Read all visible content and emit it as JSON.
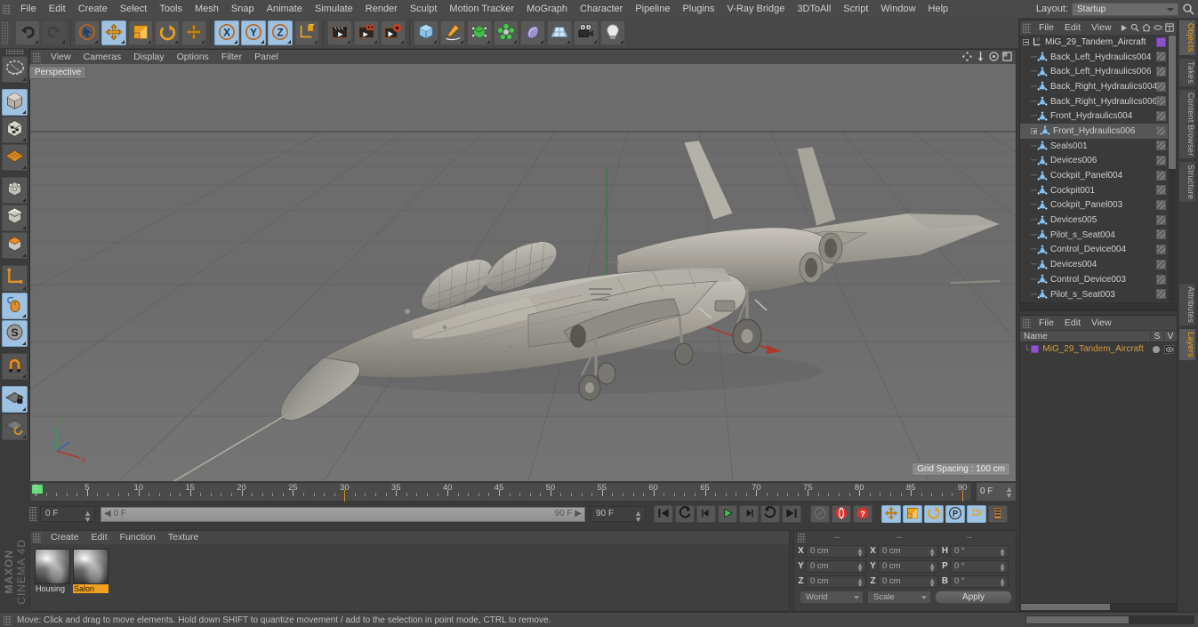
{
  "app": {
    "brand_line1": "MAXON",
    "brand_line2": "CINEMA 4D"
  },
  "menubar": {
    "items": [
      "File",
      "Edit",
      "Create",
      "Select",
      "Tools",
      "Mesh",
      "Snap",
      "Animate",
      "Simulate",
      "Render",
      "Sculpt",
      "Motion Tracker",
      "MoGraph",
      "Character",
      "Pipeline",
      "Plugins",
      "V-Ray Bridge",
      "3DToAll",
      "Script",
      "Window",
      "Help"
    ],
    "layout_label": "Layout:",
    "layout_value": "Startup",
    "search_icon": "magnifier-icon"
  },
  "toolbar": {
    "groups": [
      {
        "name": "history",
        "buttons": [
          {
            "name": "undo-button",
            "icon": "undo-arrow-icon",
            "state": "normal"
          },
          {
            "name": "redo-button",
            "icon": "redo-arrow-icon",
            "state": "disabled"
          }
        ]
      },
      {
        "name": "transform",
        "buttons": [
          {
            "name": "select-tool-button",
            "icon": "cursor-select-icon",
            "state": "normal"
          },
          {
            "name": "move-tool-button",
            "icon": "move-arrows-icon",
            "state": "active"
          },
          {
            "name": "scale-tool-button",
            "icon": "scale-box-icon",
            "state": "normal"
          },
          {
            "name": "rotate-tool-button",
            "icon": "rotate-circle-icon",
            "state": "normal"
          },
          {
            "name": "extra-move-button",
            "icon": "move-plus-icon",
            "state": "normal"
          }
        ]
      },
      {
        "name": "axis-locks",
        "buttons": [
          {
            "name": "lock-x-button",
            "icon": "axis-x-icon",
            "state": "active"
          },
          {
            "name": "lock-y-button",
            "icon": "axis-y-icon",
            "state": "active"
          },
          {
            "name": "lock-z-button",
            "icon": "axis-z-icon",
            "state": "active"
          },
          {
            "name": "world-object-coord-button",
            "icon": "world-axis-cube-icon",
            "state": "normal"
          }
        ]
      },
      {
        "name": "render",
        "buttons": [
          {
            "name": "render-view-button",
            "icon": "render-clapper-icon",
            "state": "normal"
          },
          {
            "name": "render-region-button",
            "icon": "render-region-icon",
            "state": "normal"
          },
          {
            "name": "render-settings-button",
            "icon": "render-settings-gear-icon",
            "state": "normal"
          }
        ]
      },
      {
        "name": "primitives",
        "buttons": [
          {
            "name": "cube-primitive-button",
            "icon": "blue-cube-icon",
            "state": "normal"
          },
          {
            "name": "spline-pen-button",
            "icon": "pen-spline-icon",
            "state": "normal"
          },
          {
            "name": "nurbs-button",
            "icon": "green-nurbs-cube-icon",
            "state": "normal"
          },
          {
            "name": "array-button",
            "icon": "green-cluster-icon",
            "state": "normal"
          },
          {
            "name": "deformer-button",
            "icon": "bend-deformer-icon",
            "state": "normal"
          },
          {
            "name": "floor-environment-button",
            "icon": "floor-grid-icon",
            "state": "normal"
          },
          {
            "name": "camera-button",
            "icon": "camera-icon",
            "state": "normal"
          },
          {
            "name": "light-button",
            "icon": "lightbulb-icon",
            "state": "normal"
          }
        ]
      }
    ]
  },
  "left_tools": [
    {
      "name": "live-selection-tool",
      "icon": "lasso-live-selection-icon",
      "state": "normal"
    },
    {
      "name": "model-mode-tool",
      "icon": "model-cube-icon",
      "state": "active"
    },
    {
      "name": "texture-mode-tool",
      "icon": "texture-cube-icon",
      "state": "normal"
    },
    {
      "name": "workplane-tool",
      "icon": "workplane-grid-icon",
      "state": "normal"
    },
    {
      "name": "points-mode-tool",
      "icon": "points-cube-icon",
      "state": "normal"
    },
    {
      "name": "edges-mode-tool",
      "icon": "edges-cube-icon",
      "state": "normal"
    },
    {
      "name": "polygons-mode-tool",
      "icon": "polygons-cube-icon",
      "state": "normal"
    },
    {
      "name": "axis-modification-tool",
      "icon": "axis-L-icon",
      "state": "normal"
    },
    {
      "name": "enable-tweak-tool",
      "icon": "mouse-tweak-icon",
      "state": "active"
    },
    {
      "name": "soft-selection-tool",
      "icon": "soft-selection-S-icon",
      "state": "active"
    },
    {
      "name": "magnet-tool",
      "icon": "magnet-icon",
      "state": "normal"
    },
    {
      "name": "lock-workplane-tool",
      "icon": "workplane-lock-icon",
      "state": "active"
    },
    {
      "name": "planar-workplane-tool",
      "icon": "workplane-rotate-icon",
      "state": "normal"
    }
  ],
  "viewport": {
    "menu": [
      "View",
      "Cameras",
      "Display",
      "Options",
      "Filter",
      "Panel"
    ],
    "label": "Perspective",
    "grid_spacing": "Grid Spacing : 100 cm",
    "corner_icons": [
      "pan-view-icon",
      "dolly-view-icon",
      "rotate-view-icon",
      "maximize-view-icon"
    ],
    "axis_gizmo": {
      "x": "X",
      "y": "Y",
      "z": "Z"
    },
    "scene_description": "MiG-29 Tandem fighter jet 3D model on grid floor"
  },
  "timeline": {
    "ticks": [
      0,
      5,
      10,
      15,
      20,
      25,
      30,
      35,
      40,
      45,
      50,
      55,
      60,
      65,
      70,
      75,
      80,
      85,
      90
    ],
    "start_frame": "0 F",
    "end_frame_box": "0 F",
    "current_frame_field": "0 F",
    "scrub_left": "0 F",
    "scrub_right": "90 F",
    "max_frame_field": "90 F",
    "transport": [
      {
        "name": "go-to-start-button",
        "icon": "skip-back-icon"
      },
      {
        "name": "previous-key-button",
        "icon": "rewind-key-icon"
      },
      {
        "name": "step-back-button",
        "icon": "step-back-icon"
      },
      {
        "name": "play-button",
        "icon": "play-triangle-icon"
      },
      {
        "name": "step-forward-button",
        "icon": "step-forward-icon"
      },
      {
        "name": "next-key-button",
        "icon": "forward-key-icon"
      },
      {
        "name": "go-to-end-button",
        "icon": "skip-forward-icon"
      }
    ],
    "record_group": [
      {
        "name": "autokey-button",
        "icon": "autokey-icon"
      },
      {
        "name": "record-active-objects-button",
        "icon": "record-red-circle-icon"
      },
      {
        "name": "keyframe-selection-button",
        "icon": "question-mark-red-icon"
      }
    ],
    "key_flags": [
      {
        "name": "record-position-button",
        "icon": "position-arrows-icon",
        "state": "active"
      },
      {
        "name": "record-scale-button",
        "icon": "scale-key-icon",
        "state": "active"
      },
      {
        "name": "record-rotation-button",
        "icon": "rotation-key-icon",
        "state": "active"
      },
      {
        "name": "record-pla-button",
        "icon": "pla-point-level-icon",
        "state": "active"
      },
      {
        "name": "record-parameter-button",
        "icon": "parameter-dots-icon",
        "state": "active"
      },
      {
        "name": "keyframe-preferences-button",
        "icon": "keyframe-prefs-icon",
        "state": "normal"
      }
    ]
  },
  "material_manager": {
    "menu": [
      "Create",
      "Edit",
      "Function",
      "Texture"
    ],
    "materials": [
      {
        "name": "Housing",
        "selected": false
      },
      {
        "name": "Salon",
        "selected": true
      }
    ]
  },
  "coordinates": {
    "headers": [
      "--",
      "--",
      "--"
    ],
    "rows": [
      {
        "axis": "X",
        "position": "0 cm",
        "axis2": "X",
        "size": "0 cm",
        "axis3": "H",
        "rotation": "0 °"
      },
      {
        "axis": "Y",
        "position": "0 cm",
        "axis2": "Y",
        "size": "0 cm",
        "axis3": "P",
        "rotation": "0 °"
      },
      {
        "axis": "Z",
        "position": "0 cm",
        "axis2": "Z",
        "size": "0 cm",
        "axis3": "B",
        "rotation": "0 °"
      }
    ],
    "coord_system": "World",
    "size_mode": "Scale",
    "apply_label": "Apply"
  },
  "object_manager": {
    "menu": [
      "File",
      "Edit",
      "View"
    ],
    "header_icons": [
      "play-arrow-icon",
      "magnifier-icon",
      "home-icon",
      "ellipse-icon",
      "fit-icon"
    ],
    "items": [
      {
        "label": "MiG_29_Tandem_Aircraft",
        "depth": 0,
        "expander": "minus",
        "tag": "purple",
        "selected": false
      },
      {
        "label": "Back_Left_Hydraulics004",
        "depth": 1,
        "expander": "none",
        "tag": "hatch",
        "selected": false
      },
      {
        "label": "Back_Left_Hydraulics006",
        "depth": 1,
        "expander": "none",
        "tag": "hatch",
        "selected": false
      },
      {
        "label": "Back_Right_Hydraulics004",
        "depth": 1,
        "expander": "none",
        "tag": "hatch",
        "selected": false
      },
      {
        "label": "Back_Right_Hydraulics006",
        "depth": 1,
        "expander": "none",
        "tag": "hatch",
        "selected": false
      },
      {
        "label": "Front_Hydraulics004",
        "depth": 1,
        "expander": "none",
        "tag": "hatch",
        "selected": false
      },
      {
        "label": "Front_Hydraulics006",
        "depth": 1,
        "expander": "plus",
        "tag": "hatch",
        "selected": true
      },
      {
        "label": "Seals001",
        "depth": 1,
        "expander": "none",
        "tag": "hatch",
        "selected": false
      },
      {
        "label": "Devices006",
        "depth": 1,
        "expander": "none",
        "tag": "hatch",
        "selected": false
      },
      {
        "label": "Cockpit_Panel004",
        "depth": 1,
        "expander": "none",
        "tag": "hatch",
        "selected": false
      },
      {
        "label": "Cockpit001",
        "depth": 1,
        "expander": "none",
        "tag": "hatch",
        "selected": false
      },
      {
        "label": "Cockpit_Panel003",
        "depth": 1,
        "expander": "none",
        "tag": "hatch",
        "selected": false
      },
      {
        "label": "Devices005",
        "depth": 1,
        "expander": "none",
        "tag": "hatch",
        "selected": false
      },
      {
        "label": "Pilot_s_Seat004",
        "depth": 1,
        "expander": "none",
        "tag": "hatch",
        "selected": false
      },
      {
        "label": "Control_Device004",
        "depth": 1,
        "expander": "none",
        "tag": "hatch",
        "selected": false
      },
      {
        "label": "Devices004",
        "depth": 1,
        "expander": "none",
        "tag": "hatch",
        "selected": false
      },
      {
        "label": "Control_Device003",
        "depth": 1,
        "expander": "none",
        "tag": "hatch",
        "selected": false
      },
      {
        "label": "Pilot_s_Seat003",
        "depth": 1,
        "expander": "none",
        "tag": "hatch",
        "selected": false
      }
    ]
  },
  "attribute_manager": {
    "menu": [
      "File",
      "Edit",
      "View"
    ],
    "column_name": "Name",
    "column_s": "S",
    "column_v": "V",
    "rows": [
      {
        "label": "MiG_29_Tandem_Aircraft",
        "selected": true
      }
    ]
  },
  "right_tabs": [
    {
      "label": "Objects",
      "active": true
    },
    {
      "label": "Takes",
      "active": false
    },
    {
      "label": "Content Browser",
      "active": false
    },
    {
      "label": "Structure",
      "active": false
    },
    {
      "label": "Attributes",
      "active": false
    },
    {
      "label": "Layers",
      "active": true
    }
  ],
  "statusbar": {
    "text": "Move: Click and drag to move elements. Hold down SHIFT to quantize movement / add to the selection in point mode, CTRL to remove."
  },
  "colors": {
    "accent_orange": "#f0a21e",
    "active_blue": "#9fc2e0",
    "panel_bg": "#3a3a3a",
    "toolbar_bg": "#484848",
    "viewport_bg": "#707070",
    "axis_x": "#c0392b",
    "axis_y": "#27ae60",
    "axis_z": "#2f6fd0"
  }
}
